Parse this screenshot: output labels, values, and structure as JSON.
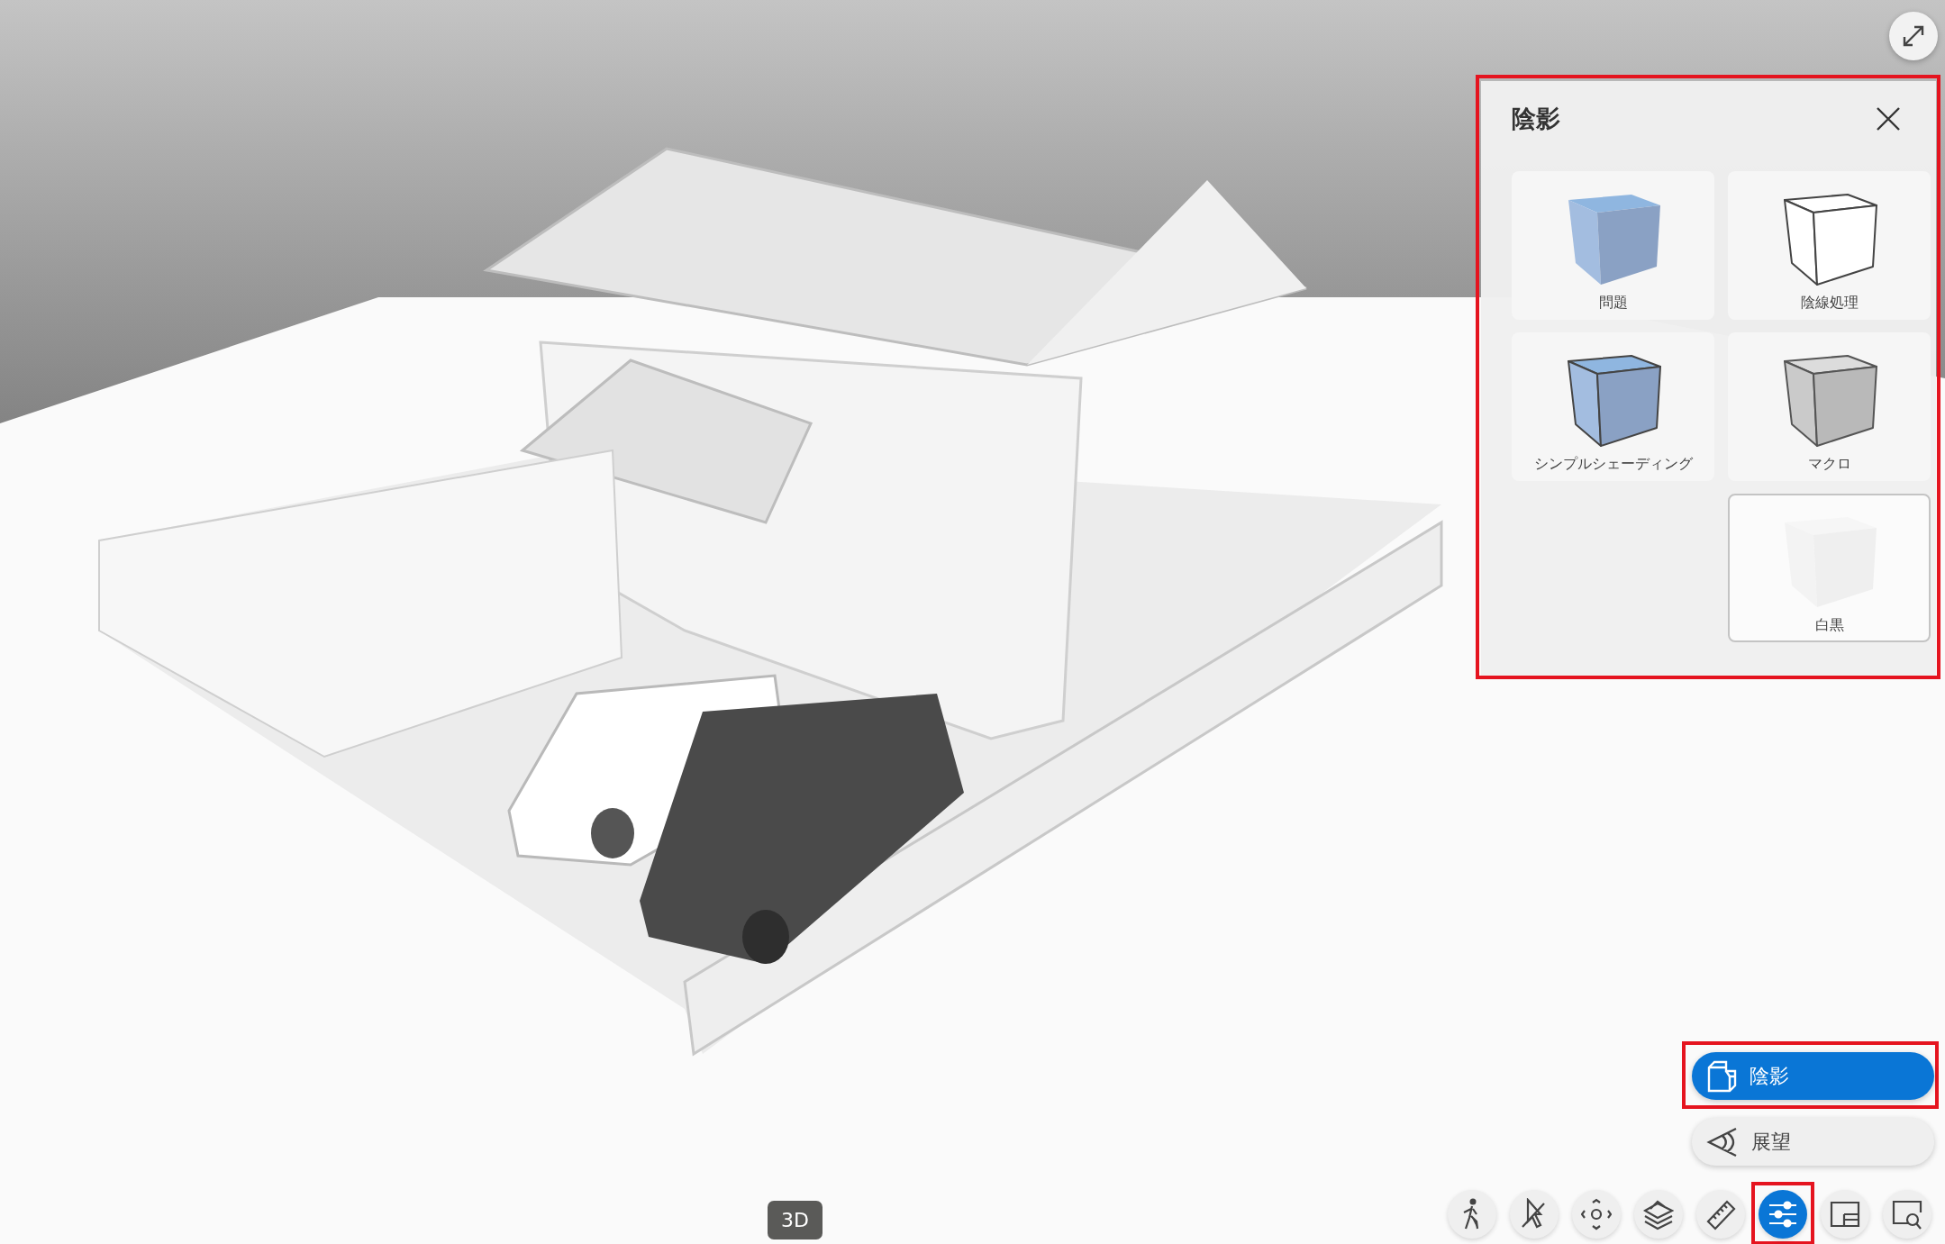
{
  "shading_panel": {
    "title": "陰影",
    "modes": [
      {
        "label": "問題",
        "kind": "blue",
        "selected": false
      },
      {
        "label": "陰線処理",
        "kind": "outline",
        "selected": false
      },
      {
        "label": "シンプルシェーディング",
        "kind": "blue-outline",
        "selected": false
      },
      {
        "label": "マクロ",
        "kind": "gray",
        "selected": false
      },
      {
        "label": "白黒",
        "kind": "white",
        "selected": true
      }
    ]
  },
  "menu_buttons": [
    {
      "label": "陰影",
      "kind": "shading",
      "selected": true
    },
    {
      "label": "展望",
      "kind": "view",
      "selected": false
    }
  ],
  "toolbar": [
    {
      "kind": "walk",
      "selected": false
    },
    {
      "kind": "select",
      "selected": false
    },
    {
      "kind": "move",
      "selected": false
    },
    {
      "kind": "layers",
      "selected": false
    },
    {
      "kind": "ruler",
      "selected": false
    },
    {
      "kind": "settings",
      "selected": true
    },
    {
      "kind": "layout",
      "selected": false
    },
    {
      "kind": "zoom",
      "selected": false
    }
  ],
  "view_badge": "3D"
}
